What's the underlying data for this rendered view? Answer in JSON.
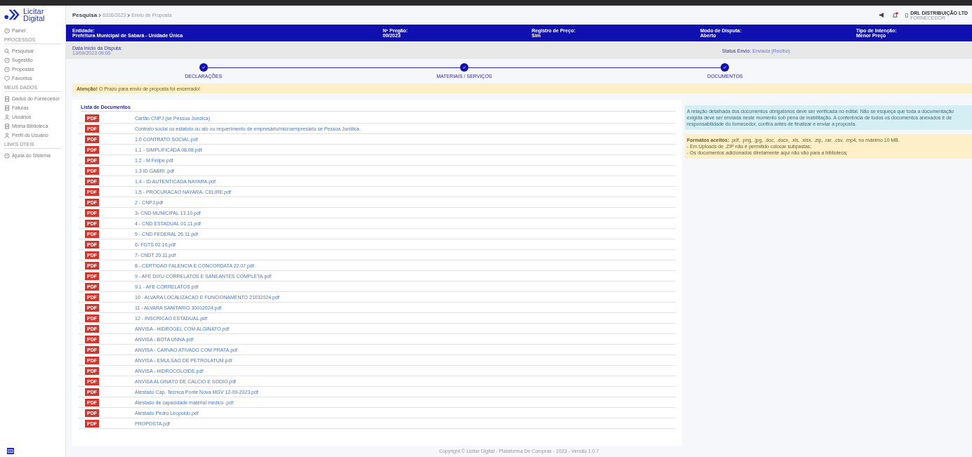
{
  "logo": {
    "line1": "Licitar",
    "line2": "Digital"
  },
  "sidebar": {
    "items": [
      {
        "kind": "item",
        "label": "Painel"
      },
      {
        "kind": "section",
        "label": "PROCESSOS"
      },
      {
        "kind": "item",
        "label": "Pesquisar"
      },
      {
        "kind": "item",
        "label": "Sugestão"
      },
      {
        "kind": "item",
        "label": "Propostas"
      },
      {
        "kind": "item",
        "label": "Favoritos"
      },
      {
        "kind": "section",
        "label": "MEUS DADOS"
      },
      {
        "kind": "item",
        "label": "Dados do Fornecedor"
      },
      {
        "kind": "item",
        "label": "Faturas"
      },
      {
        "kind": "item",
        "label": "Usuários"
      },
      {
        "kind": "item",
        "label": "Minha Biblioteca"
      },
      {
        "kind": "item",
        "label": "Perfil do Usuário"
      },
      {
        "kind": "section",
        "label": "LINKS ÚTEIS"
      },
      {
        "kind": "item",
        "label": "Ajuda do Sistema"
      }
    ]
  },
  "breadcrumb": [
    "Pesquisa",
    "6326/2023",
    "Envio de Proposta"
  ],
  "user": {
    "name": "DRL DISTRIBUIÇÃO LTD",
    "role": "FORNECEDOR",
    "has_notification": true
  },
  "summary": [
    {
      "label": "Entidade:",
      "value": "Prefeitura Municipal de Sabará - Unidade Única"
    },
    {
      "label": "Nº Pregão:",
      "value": "00/2023"
    },
    {
      "label": "Registro de Preço:",
      "value": "Sim"
    },
    {
      "label": "Modo de Disputa:",
      "value": "Aberto"
    },
    {
      "label": "Tipo de Intenção:",
      "value": "Menor Preço"
    }
  ],
  "dispute": {
    "label": "Data Início da Disputa:",
    "value": "13/09/2023 09:00"
  },
  "status": {
    "label": "Status Envio:",
    "value": "Enviada (Recibo)"
  },
  "steps": [
    {
      "label": "DECLARAÇÕES",
      "done": true
    },
    {
      "label": "MATERIAIS / SERVIÇOS",
      "done": true
    },
    {
      "label": "DOCUMENTOS",
      "done": true
    }
  ],
  "warning": "**Atenção!** O Prazo para envio de proposta foi encerrado!",
  "documents": {
    "title": "Lista de Documentos",
    "items": [
      {
        "badge": "PDF",
        "name": "Cartão CNPJ (se Pessoa Jurídica)"
      },
      {
        "badge": "PDF",
        "name": "Contrato social ou estatuto ou ato ou requerimento de empresário/microempresário se Pessoa Jurídica."
      },
      {
        "badge": "PDF",
        "name": "1.0 CONTRATO SOCIAL.pdf"
      },
      {
        "badge": "PDF",
        "name": "1.1 - SIMPLIFICADA 08.08.pdf"
      },
      {
        "badge": "PDF",
        "name": "1.2 - M Felipe.pdf"
      },
      {
        "badge": "PDF",
        "name": "1.3 ID GABRI .pdf"
      },
      {
        "badge": "PDF",
        "name": "1.4 - ID AUTENTICADA NAYARA.pdf"
      },
      {
        "badge": "PDF",
        "name": "1.5 - PROCURACAO NAYARA- CELIRE.pdf"
      },
      {
        "badge": "PDF",
        "name": "2 - CNPJ.pdf"
      },
      {
        "badge": "PDF",
        "name": "3- CND MUNICIPAL 13.10.pdf"
      },
      {
        "badge": "PDF",
        "name": "4 - CND ESTADUAL 01.11.pdf"
      },
      {
        "badge": "PDF",
        "name": "5 - CND FEDERAL 26.11.pdf"
      },
      {
        "badge": "PDF",
        "name": "6- FGTS 02.10.pdf"
      },
      {
        "badge": "PDF",
        "name": "7- CNDT 20.11.pdf"
      },
      {
        "badge": "PDF",
        "name": "8 - CERTIDAO FALENCIA E CONCORDATA 22.07.pdf"
      },
      {
        "badge": "PDF",
        "name": "9 - AFE DIXU CORRELATOS E SANEANTES COMPLETA.pdf"
      },
      {
        "badge": "PDF",
        "name": "9.1 - AFE CORRELATOS.pdf"
      },
      {
        "badge": "PDF",
        "name": "10 - ALVARA LOCALIZACAO E FUNCIONAMENTO 21032024.pdf"
      },
      {
        "badge": "PDF",
        "name": "11 - ALVARA SANITARIO 30012024.pdf"
      },
      {
        "badge": "PDF",
        "name": "12 - INSCRICAO ESTADUAL.pdf"
      },
      {
        "badge": "PDF",
        "name": "ANVISA - HIDROGEL COM ALGINATO.pdf"
      },
      {
        "badge": "PDF",
        "name": "ANVISA - BOTA UNNA.pdf"
      },
      {
        "badge": "PDF",
        "name": "ANVISA - CARVAO ATIVADO COM PRATA.pdf"
      },
      {
        "badge": "PDF",
        "name": "ANVISA - EMULSAO DE PETROLATUM.pdf"
      },
      {
        "badge": "PDF",
        "name": "ANVISA - HIDROCOLOIDE.pdf"
      },
      {
        "badge": "PDF",
        "name": "ANVISA ALGINATO DE CALCIO E SODIO.pdf"
      },
      {
        "badge": "PDF",
        "name": "Atestado Cap. Tecnica Ponte Nova MGV 12-09-2023.pdf"
      },
      {
        "badge": "PDF",
        "name": "Atestado de capacidade material medico .pdf"
      },
      {
        "badge": "PDF",
        "name": "Atestado Pedro Leopoldo.pdf"
      },
      {
        "badge": "PDF",
        "name": "PROPOSTA.pdf"
      }
    ]
  },
  "info": "A relação detalhada dos documentos obrigatórios deve ser verificada no edital. Não se esqueça que toda a documentação exigida deve ser enviada neste momento sob pena de inabilitação. A conferência de todos os documentos anexados é de responsabilidade do fornecedor, confira antes de finalizar e enviar a proposta.",
  "formats": [
    "**Formatos aceitos:** .pdf, .png, .jpg, .doc, .docx, .xls, .xlsx, .zip, .rar, .csv, .mp4; no máximo 10 MB.",
    "- Em Uploads de .ZIP não é permitido colocar subpastas;",
    "- Os documentos adicionados diretamente aqui não vão para a biblioteca;"
  ],
  "footer": "Copyright © Licitar Digital - Plataforma De Compras - 2023 - Versão 1.0.7"
}
